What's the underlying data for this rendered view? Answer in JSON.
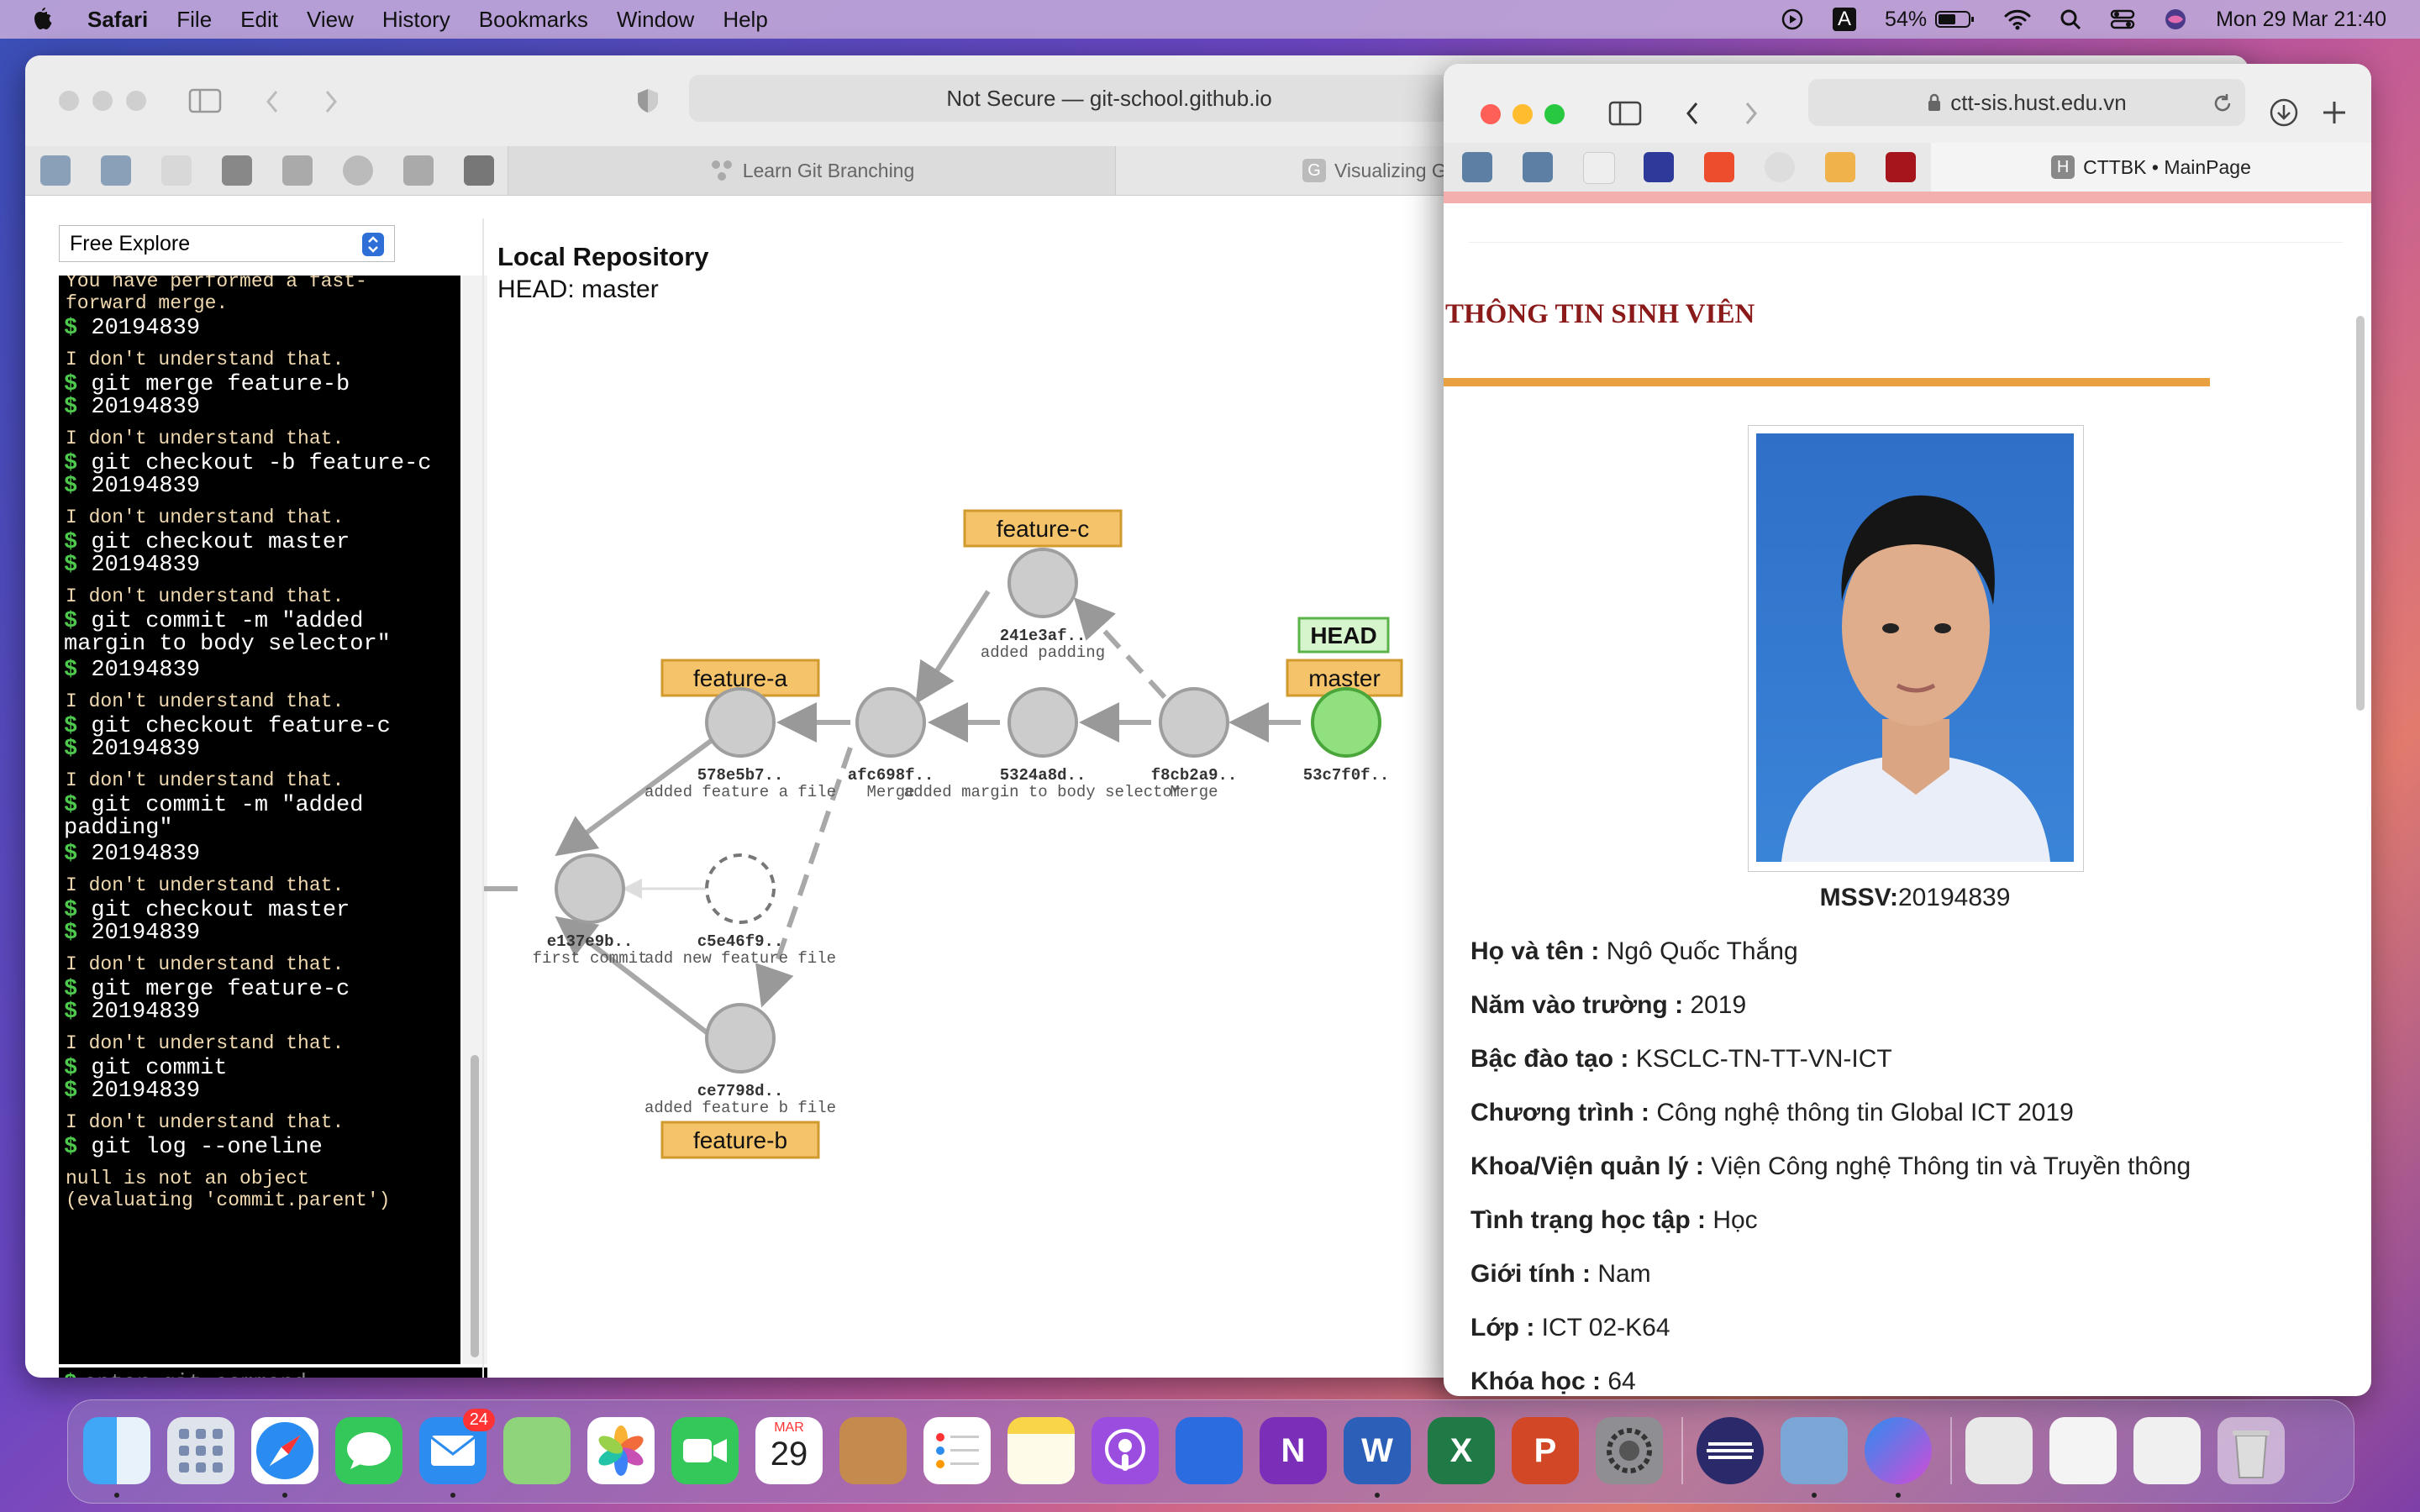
{
  "menubar": {
    "apple": "",
    "app": "Safari",
    "menus": [
      "File",
      "Edit",
      "View",
      "History",
      "Bookmarks",
      "Window",
      "Help"
    ],
    "battery": "54%",
    "datetime": "Mon 29 Mar  21:40",
    "input_source": "A"
  },
  "window1": {
    "url": "Not Secure — git-school.github.io",
    "tabs": [
      "Learn Git Branching",
      "Visualizing G"
    ],
    "level_select": "Free Explore",
    "console_lines": [
      {
        "type": "resp",
        "text": "You have performed a fast-"
      },
      {
        "type": "resp",
        "text": "forward merge."
      },
      {
        "type": "cmd",
        "text": "20194839"
      },
      {
        "type": "resp",
        "text": "I don't understand that."
      },
      {
        "type": "cmd",
        "text": "git merge feature-b"
      },
      {
        "type": "cmd2",
        "text": "20194839"
      },
      {
        "type": "resp",
        "text": "I don't understand that."
      },
      {
        "type": "cmd",
        "text": "git checkout -b feature-c"
      },
      {
        "type": "cmd2",
        "text": "20194839"
      },
      {
        "type": "resp",
        "text": "I don't understand that."
      },
      {
        "type": "cmd",
        "text": "git checkout master"
      },
      {
        "type": "cmd2",
        "text": "20194839"
      },
      {
        "type": "resp",
        "text": "I don't understand that."
      },
      {
        "type": "cmd",
        "text": "git commit -m \"added"
      },
      {
        "type": "cont",
        "text": "margin to body selector\""
      },
      {
        "type": "cmd",
        "text": "20194839"
      },
      {
        "type": "resp",
        "text": "I don't understand that."
      },
      {
        "type": "cmd",
        "text": "git checkout feature-c"
      },
      {
        "type": "cmd2",
        "text": "20194839"
      },
      {
        "type": "resp",
        "text": "I don't understand that."
      },
      {
        "type": "cmd",
        "text": "git commit -m \"added"
      },
      {
        "type": "cont",
        "text": "padding\""
      },
      {
        "type": "cmd",
        "text": "20194839"
      },
      {
        "type": "resp",
        "text": "I don't understand that."
      },
      {
        "type": "cmd",
        "text": "git checkout master"
      },
      {
        "type": "cmd2",
        "text": "20194839"
      },
      {
        "type": "resp",
        "text": "I don't understand that."
      },
      {
        "type": "cmd",
        "text": "git merge feature-c"
      },
      {
        "type": "cmd2",
        "text": "20194839"
      },
      {
        "type": "resp",
        "text": "I don't understand that."
      },
      {
        "type": "cmd",
        "text": "git commit"
      },
      {
        "type": "cmd2",
        "text": "20194839"
      },
      {
        "type": "resp",
        "text": "I don't understand that."
      },
      {
        "type": "cmd",
        "text": "git log --oneline"
      },
      {
        "type": "resp",
        "text": "null is not an object"
      },
      {
        "type": "resp",
        "text": "(evaluating 'commit.parent')"
      }
    ],
    "input_placeholder": "enter git command",
    "repo_title": "Local Repository",
    "repo_head": "HEAD: master",
    "commits": [
      {
        "hash": "e137e9b..",
        "msg": "first commit"
      },
      {
        "hash": "c5e46f9..",
        "msg": "add new feature file"
      },
      {
        "hash": "578e5b7..",
        "msg": "added feature a file"
      },
      {
        "hash": "afc698f..",
        "msg": "Merge"
      },
      {
        "hash": "241e3af..",
        "msg": "added padding"
      },
      {
        "hash": "5324a8d..",
        "msg": "added margin to body selector"
      },
      {
        "hash": "f8cb2a9..",
        "msg": "Merge"
      },
      {
        "hash": "53c7f0f..",
        "msg": ""
      },
      {
        "hash": "ce7798d..",
        "msg": "added feature b file"
      }
    ],
    "branches": {
      "feature_a": "feature-a",
      "feature_b": "feature-b",
      "feature_c": "feature-c",
      "master": "master",
      "head": "HEAD"
    }
  },
  "window2": {
    "url": "ctt-sis.hust.edu.vn",
    "tab": "CTTBK • MainPage",
    "section_title": "THÔNG TIN SINH VIÊN",
    "mssv_label": "MSSV:",
    "mssv_value": "20194839",
    "fields": [
      {
        "label": "Họ và tên :",
        "value": "Ngô Quốc Thắng"
      },
      {
        "label": "Năm vào trường :",
        "value": "2019"
      },
      {
        "label": "Bậc đào tạo :",
        "value": "KSCLC-TN-TT-VN-ICT"
      },
      {
        "label": "Chương trình :",
        "value": "Công nghệ thông tin Global ICT 2019"
      },
      {
        "label": "Khoa/Viện quản lý :",
        "value": "Viện Công nghệ Thông tin và Truyền thông"
      },
      {
        "label": "Tình trạng học tập :",
        "value": "Học"
      },
      {
        "label": "Giới tính :",
        "value": "Nam"
      },
      {
        "label": "Lớp :",
        "value": "ICT 02-K64"
      },
      {
        "label": "Khóa học :",
        "value": "64"
      }
    ]
  },
  "dock": {
    "calendar_month": "MAR",
    "calendar_day": "29",
    "mail_badge": "24"
  },
  "colors": {
    "branch_fill": "#f5c46a",
    "head_fill": "#cff0c0",
    "master_commit": "#90e080",
    "commit_fill": "#cccccc",
    "title_red": "#8b1a1a",
    "accent_orange": "#e8a040"
  }
}
